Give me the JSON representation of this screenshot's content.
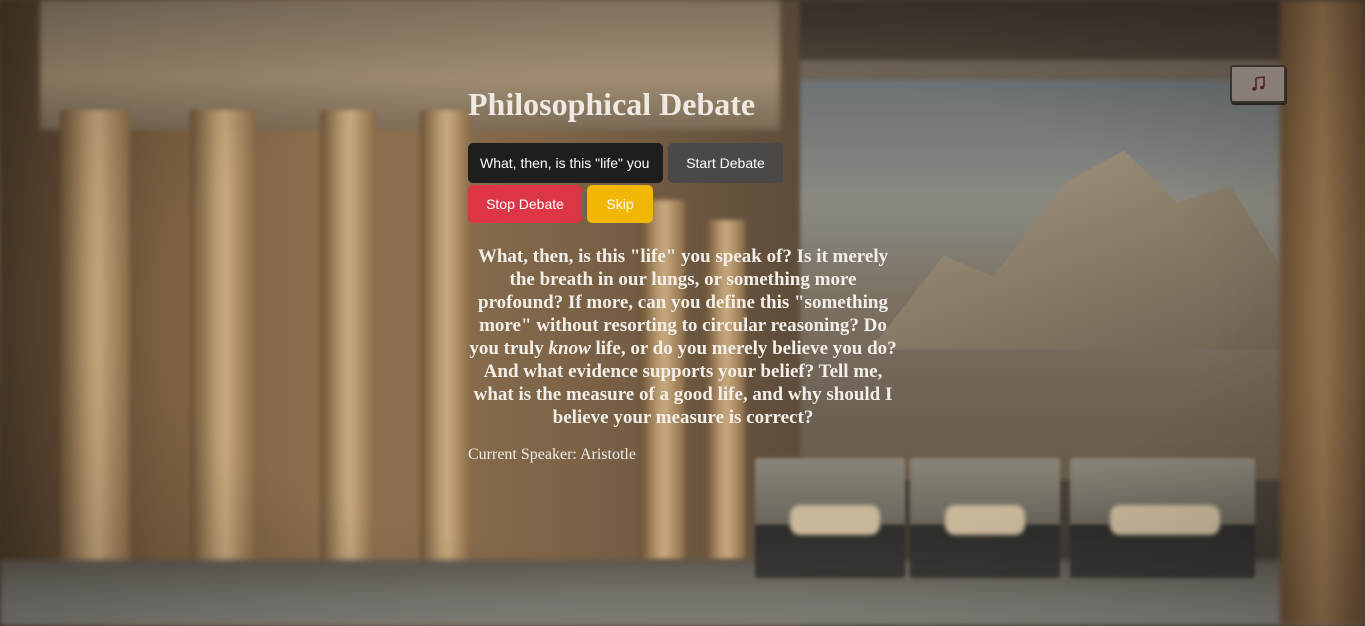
{
  "page": {
    "title": "Philosophical Debate"
  },
  "music": {
    "icon": "music-note-icon"
  },
  "topic": {
    "value": "What, then, is this \"life\" you speak of?",
    "placeholder": ""
  },
  "buttons": {
    "start": "Start Debate",
    "stop": "Stop Debate",
    "skip": "Skip"
  },
  "speech": {
    "part1": "What, then, is this \"life\" you speak of? Is it merely the breath in our lungs, or something more profound? If more, can you define this \"something more\" without resorting to circular reasoning? Do you truly ",
    "emphasis": "know",
    "part2": " life, or do you merely believe you do? And what evidence supports your belief? Tell me, what is the measure of a good life, and why should I believe your measure is correct?"
  },
  "speaker": {
    "label": "Current Speaker: ",
    "name": "Aristotle"
  },
  "colors": {
    "start_button": "#4a4948",
    "stop_button": "#dc3545",
    "skip_button": "#f2b705",
    "input_bg": "#1f1e1e"
  }
}
